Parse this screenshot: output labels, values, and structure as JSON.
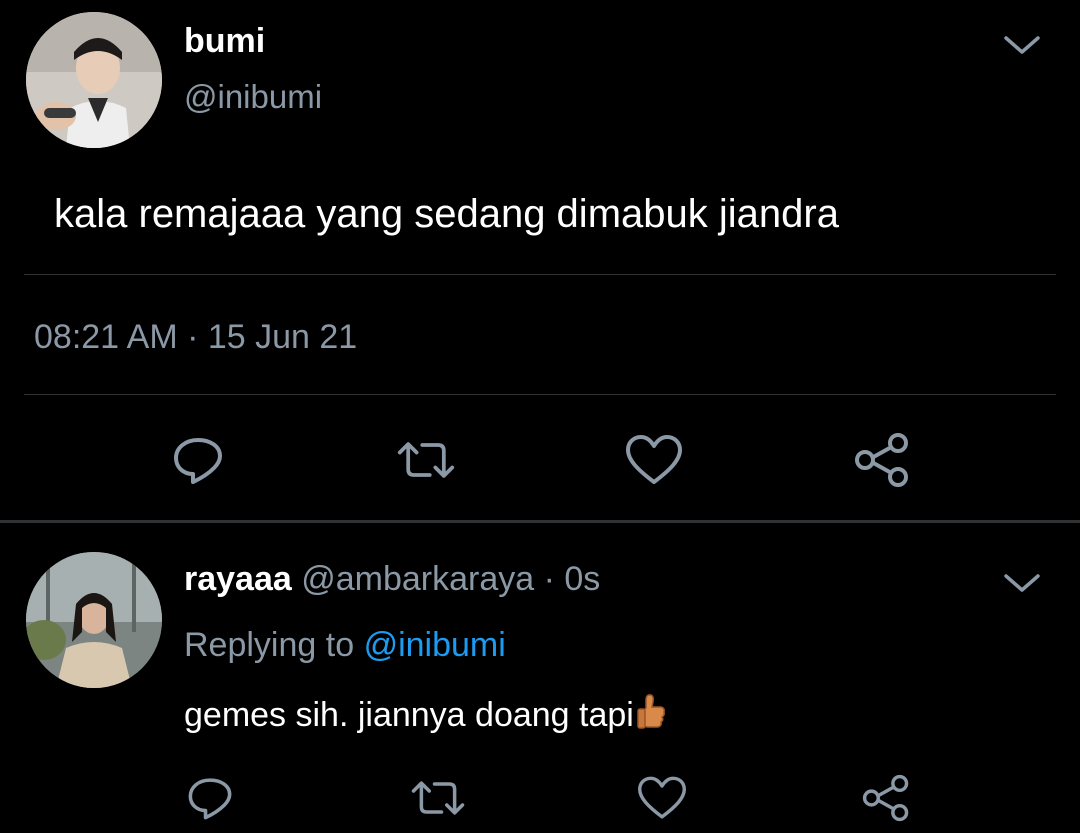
{
  "main_tweet": {
    "author_name": "bumi",
    "author_handle": "@inibumi",
    "text": "kala remajaaa yang sedang dimabuk jiandra",
    "timestamp": "08:21 AM · 15 Jun 21"
  },
  "reply": {
    "author_name": "rayaaa",
    "meta": "@ambarkaraya · 0s",
    "replying_prefix": "Replying to",
    "replying_mention": "@inibumi",
    "text": "gemes sih. jiannya doang tapi",
    "emoji": "thumbs-up-emoji"
  },
  "icons": {
    "more": "chevron-down-icon",
    "reply": "reply-icon",
    "retweet": "retweet-icon",
    "like": "heart-icon",
    "share": "share-icon"
  },
  "colors": {
    "background": "#000000",
    "primary_text": "#ffffff",
    "secondary_text": "#8b98a5",
    "link": "#1d9bf0",
    "divider": "#2f3336"
  }
}
